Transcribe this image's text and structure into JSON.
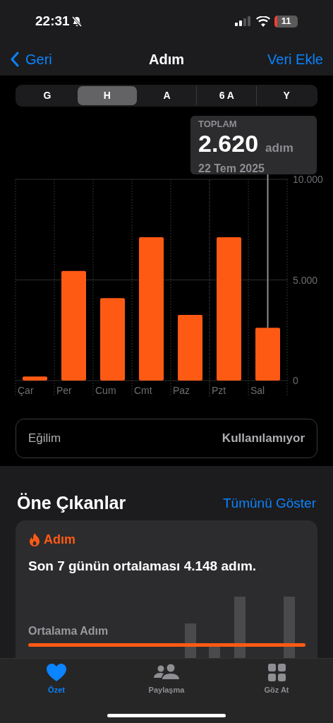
{
  "status_bar": {
    "time": "22:31",
    "battery": "11"
  },
  "nav": {
    "back": "Geri",
    "title": "Adım",
    "action": "Veri Ekle"
  },
  "segments": [
    {
      "label": "G",
      "selected": false
    },
    {
      "label": "H",
      "selected": true
    },
    {
      "label": "A",
      "selected": false
    },
    {
      "label": "6 A",
      "selected": false
    },
    {
      "label": "Y",
      "selected": false
    }
  ],
  "tooltip": {
    "heading": "TOPLAM",
    "value": "2.620",
    "unit": "adım",
    "date": "22 Tem 2025"
  },
  "chart_data": {
    "type": "bar",
    "categories": [
      "Çar",
      "Per",
      "Cum",
      "Cmt",
      "Paz",
      "Pzt",
      "Sal"
    ],
    "series": [
      {
        "color": "#ff5a14",
        "values": [
          200,
          5450,
          4100,
          7120,
          3260,
          7120,
          2620
        ]
      }
    ],
    "ylim": [
      0,
      10000
    ],
    "yticks": [
      {
        "value": 0,
        "label": "0"
      },
      {
        "value": 5000,
        "label": "5.000"
      },
      {
        "value": 10000,
        "label": "10.000"
      }
    ]
  },
  "trend": {
    "label": "Eğilim",
    "value": "Kullanılamıyor"
  },
  "highlights": {
    "title": "Öne Çıkanlar",
    "link": "Tümünü Göster",
    "card": {
      "category": "Adım",
      "sentence": "Son 7 günün ortalaması 4.148 adım.",
      "metric": "Ortalama Adım"
    }
  },
  "tab_bar": [
    {
      "label": "Özet",
      "selected": true
    },
    {
      "label": "Paylaşma",
      "selected": false
    },
    {
      "label": "Göz At",
      "selected": false
    }
  ]
}
